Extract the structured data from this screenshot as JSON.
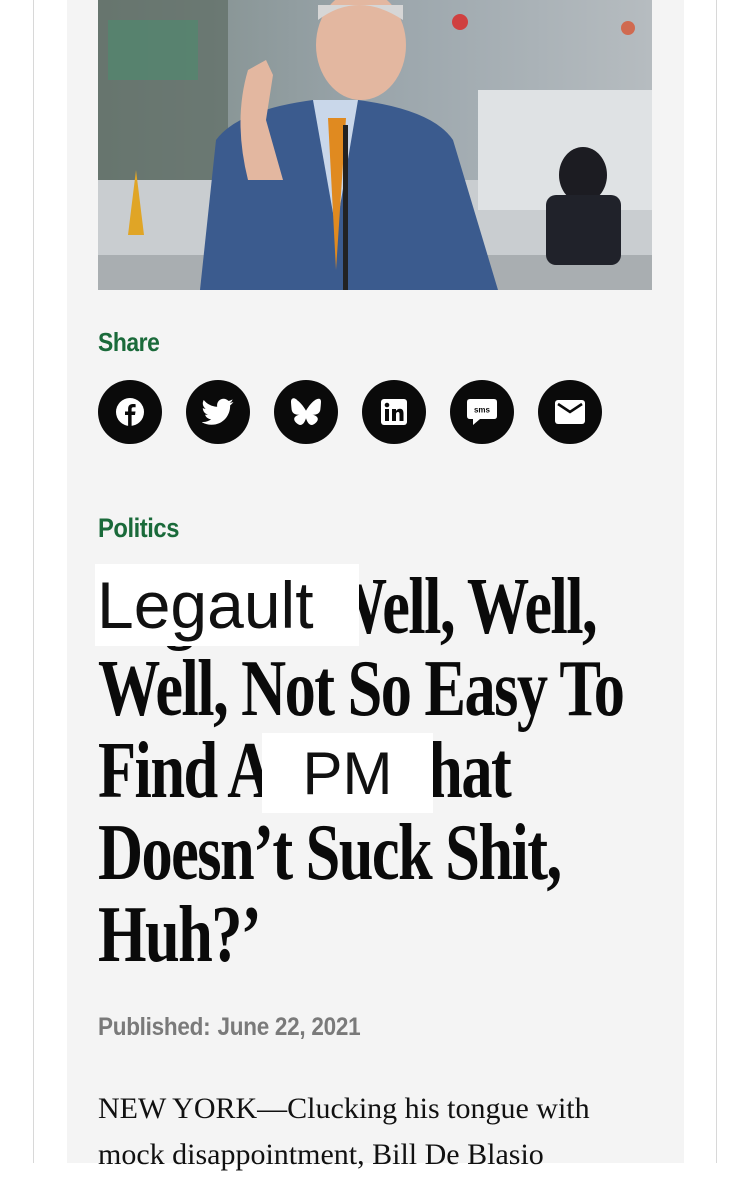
{
  "share": {
    "label": "Share",
    "buttons": [
      {
        "name": "facebook-share-button",
        "icon": "facebook-icon"
      },
      {
        "name": "twitter-share-button",
        "icon": "twitter-icon"
      },
      {
        "name": "bluesky-share-button",
        "icon": "bluesky-icon"
      },
      {
        "name": "linkedin-share-button",
        "icon": "linkedin-icon"
      },
      {
        "name": "sms-share-button",
        "icon": "sms-icon",
        "icon_text": "sms"
      },
      {
        "name": "email-share-button",
        "icon": "email-icon"
      }
    ]
  },
  "article": {
    "category": "Politics",
    "headline_lines": [
      "Legault ‘Well, Well,",
      "Well, Not So Easy To",
      "Find A PM That",
      "Doesn’t Suck Shit,",
      "Huh?’"
    ],
    "overlay_1": "Legault",
    "overlay_2": "PM",
    "published_label": "Published:",
    "published_date": "June 22, 2021",
    "body_lines": [
      "NEW YORK—Clucking his tongue with",
      "mock disappointment, Bill De Blasio"
    ]
  },
  "colors": {
    "accent_green": "#1a6a3a",
    "icon_bg": "#0a0a0a",
    "card_bg": "#f4f4f4"
  }
}
